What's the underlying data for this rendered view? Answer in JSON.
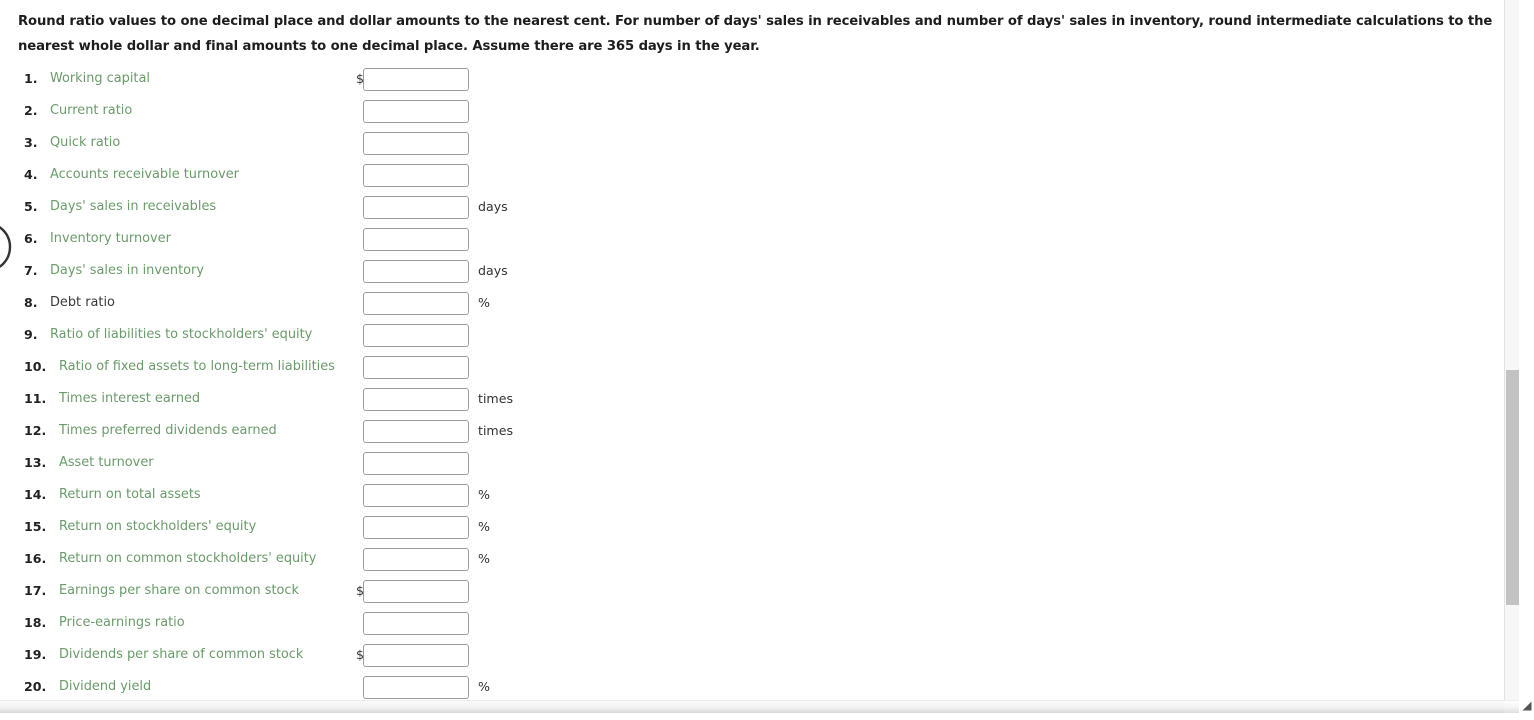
{
  "instructions": {
    "text": "Round ratio values to one decimal place and dollar amounts to the nearest cent. For number of days' sales in receivables and number of days' sales in inventory, round intermediate calculations to the nearest whole dollar and final amounts to one decimal place. Assume there are 365 days in the year."
  },
  "colors": {
    "label_green": "#6a9b6a",
    "label_dark": "#3a3a3a",
    "number_dark": "#222222",
    "field_border": "#9a9a9a",
    "scrollbar_thumb": "#c2c2c2",
    "background": "#ffffff"
  },
  "rows": [
    {
      "num": "1.",
      "label": "Working capital",
      "value": "",
      "prefix": "$",
      "suffix": "",
      "label_style": "green"
    },
    {
      "num": "2.",
      "label": "Current ratio",
      "value": "",
      "prefix": "",
      "suffix": "",
      "label_style": "green"
    },
    {
      "num": "3.",
      "label": "Quick ratio",
      "value": "",
      "prefix": "",
      "suffix": "",
      "label_style": "green"
    },
    {
      "num": "4.",
      "label": "Accounts receivable turnover",
      "value": "",
      "prefix": "",
      "suffix": "",
      "label_style": "green"
    },
    {
      "num": "5.",
      "label": "Days' sales in receivables",
      "value": "",
      "prefix": "",
      "suffix": "days",
      "label_style": "green"
    },
    {
      "num": "6.",
      "label": "Inventory turnover",
      "value": "",
      "prefix": "",
      "suffix": "",
      "label_style": "green"
    },
    {
      "num": "7.",
      "label": "Days' sales in inventory",
      "value": "",
      "prefix": "",
      "suffix": "days",
      "label_style": "green"
    },
    {
      "num": "8.",
      "label": "Debt ratio",
      "value": "",
      "prefix": "",
      "suffix": "%",
      "label_style": "plain"
    },
    {
      "num": "9.",
      "label": "Ratio of liabilities to stockholders' equity",
      "value": "",
      "prefix": "",
      "suffix": "",
      "label_style": "green"
    },
    {
      "num": "10.",
      "label": "Ratio of fixed assets to long-term liabilities",
      "value": "",
      "prefix": "",
      "suffix": "",
      "label_style": "green"
    },
    {
      "num": "11.",
      "label": "Times interest earned",
      "value": "",
      "prefix": "",
      "suffix": "times",
      "label_style": "green"
    },
    {
      "num": "12.",
      "label": "Times preferred dividends earned",
      "value": "",
      "prefix": "",
      "suffix": "times",
      "label_style": "green"
    },
    {
      "num": "13.",
      "label": "Asset turnover",
      "value": "",
      "prefix": "",
      "suffix": "",
      "label_style": "green"
    },
    {
      "num": "14.",
      "label": "Return on total assets",
      "value": "",
      "prefix": "",
      "suffix": "%",
      "label_style": "green"
    },
    {
      "num": "15.",
      "label": "Return on stockholders' equity",
      "value": "",
      "prefix": "",
      "suffix": "%",
      "label_style": "green"
    },
    {
      "num": "16.",
      "label": "Return on common stockholders' equity",
      "value": "",
      "prefix": "",
      "suffix": "%",
      "label_style": "green"
    },
    {
      "num": "17.",
      "label": "Earnings per share on common stock",
      "value": "",
      "prefix": "$",
      "suffix": "",
      "label_style": "green"
    },
    {
      "num": "18.",
      "label": "Price-earnings ratio",
      "value": "",
      "prefix": "",
      "suffix": "",
      "label_style": "green"
    },
    {
      "num": "19.",
      "label": "Dividends per share of common stock",
      "value": "",
      "prefix": "$",
      "suffix": "",
      "label_style": "green"
    },
    {
      "num": "20.",
      "label": "Dividend yield",
      "value": "",
      "prefix": "",
      "suffix": "%",
      "label_style": "green"
    }
  ]
}
